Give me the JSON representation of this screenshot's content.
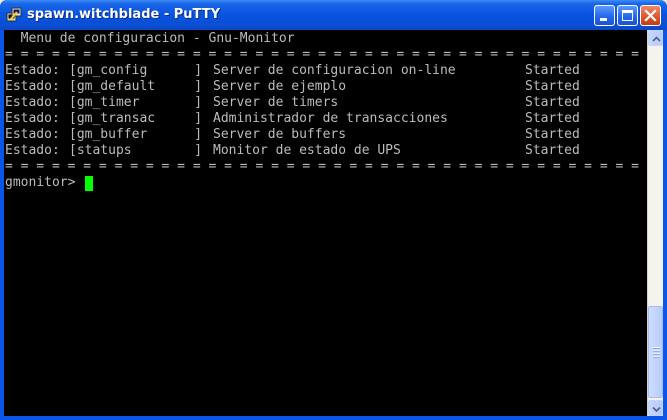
{
  "window": {
    "title": "spawn.witchblade - PuTTY",
    "icon": "putty-icon",
    "controls": [
      "minimize-icon",
      "maximize-icon",
      "close-icon"
    ]
  },
  "terminal": {
    "menu_title": "  Menu de configuracion - Gnu-Monitor",
    "separator": "= = = = = = = = = = = = = = = = = = = = = = = = = = = = = = = = = = = = = = = = =",
    "services": [
      {
        "label": "Estado:",
        "name": "[gm_config      ]",
        "description": "Server de configuracion on-line",
        "status": "Started"
      },
      {
        "label": "Estado:",
        "name": "[gm_default     ]",
        "description": "Server de ejemplo",
        "status": "Started"
      },
      {
        "label": "Estado:",
        "name": "[gm_timer       ]",
        "description": "Server de timers",
        "status": "Started"
      },
      {
        "label": "Estado:",
        "name": "[gm_transac     ]",
        "description": "Administrador de transacciones",
        "status": "Started"
      },
      {
        "label": "Estado:",
        "name": "[gm_buffer      ]",
        "description": "Server de buffers",
        "status": "Started"
      },
      {
        "label": "Estado:",
        "name": "[statups        ]",
        "description": "Monitor de estado de UPS",
        "status": "Started"
      }
    ],
    "prompt": "gmonitor> "
  },
  "colors": {
    "terminal_bg": "#000000",
    "terminal_fg": "#bbbbbb",
    "cursor": "#00ff00",
    "titlebar": "#0853df"
  }
}
